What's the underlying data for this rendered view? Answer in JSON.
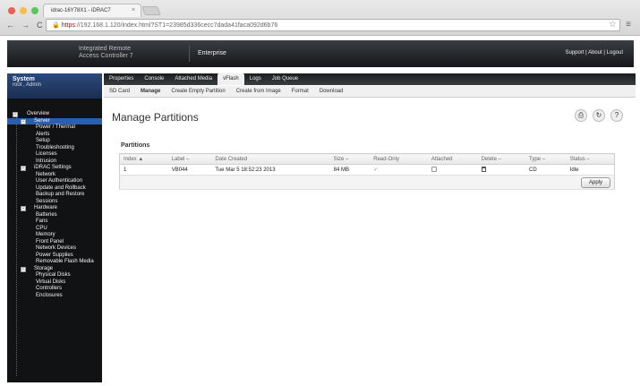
{
  "browser": {
    "tab_title": "idrac-16Y78X1 - iDRAC7",
    "url_scheme": "https",
    "url_host_path": "://192.168.1.120/index.html?ST1=23985d336cecc7dada41faca092d6b76"
  },
  "banner": {
    "product_line1": "Integrated Remote",
    "product_line2": "Access Controller 7",
    "license": "Enterprise",
    "links": "Support  |  About  |  Logout"
  },
  "sidebar": {
    "system_title": "System",
    "user": "root , Admin",
    "items": [
      {
        "label": "Overview",
        "level": 0,
        "box": "-"
      },
      {
        "label": "Server",
        "level": 1,
        "box": "-",
        "selected": true
      },
      {
        "label": "Power / Thermal",
        "level": 2
      },
      {
        "label": "Alerts",
        "level": 2
      },
      {
        "label": "Setup",
        "level": 2
      },
      {
        "label": "Troubleshooting",
        "level": 2
      },
      {
        "label": "Licenses",
        "level": 2
      },
      {
        "label": "Intrusion",
        "level": 2
      },
      {
        "label": "iDRAC Settings",
        "level": 1,
        "box": "-"
      },
      {
        "label": "Network",
        "level": 2
      },
      {
        "label": "User Authentication",
        "level": 2
      },
      {
        "label": "Update and Rollback",
        "level": 2
      },
      {
        "label": "Backup and Restore",
        "level": 2
      },
      {
        "label": "Sessions",
        "level": 2
      },
      {
        "label": "Hardware",
        "level": 1,
        "box": "-"
      },
      {
        "label": "Batteries",
        "level": 2
      },
      {
        "label": "Fans",
        "level": 2
      },
      {
        "label": "CPU",
        "level": 2
      },
      {
        "label": "Memory",
        "level": 2
      },
      {
        "label": "Front Panel",
        "level": 2
      },
      {
        "label": "Network Devices",
        "level": 2
      },
      {
        "label": "Power Supplies",
        "level": 2
      },
      {
        "label": "Removable Flash Media",
        "level": 2
      },
      {
        "label": "Storage",
        "level": 1,
        "box": "-"
      },
      {
        "label": "Physical Disks",
        "level": 2
      },
      {
        "label": "Virtual Disks",
        "level": 2
      },
      {
        "label": "Controllers",
        "level": 2
      },
      {
        "label": "Enclosures",
        "level": 2
      }
    ]
  },
  "tabs_primary": [
    "Properties",
    "Console",
    "Attached Media",
    "vFlash",
    "Logs",
    "Job Queue"
  ],
  "tabs_primary_active": 3,
  "tabs_secondary": [
    "SD Card",
    "Manage",
    "Create Empty Partition",
    "Create from Image",
    "Format",
    "Download"
  ],
  "tabs_secondary_active": 1,
  "page_title": "Manage Partitions",
  "toolbar_icons": [
    "print-icon",
    "refresh-icon",
    "help-icon"
  ],
  "toolbar_glyphs": [
    "⎙",
    "↻",
    "?"
  ],
  "section_title": "Partitions",
  "table": {
    "headers": [
      "Index ▲",
      "Label –",
      "Date Created",
      "Size –",
      "Read-Only",
      "Attached",
      "Delete –",
      "Type –",
      "Status –"
    ],
    "rows": [
      [
        "1",
        "VB044",
        "Tue Mar 5 18:52:23 2013",
        "84 MB",
        "✓",
        "",
        "",
        "CD",
        "Idle"
      ]
    ]
  },
  "apply_label": "Apply"
}
